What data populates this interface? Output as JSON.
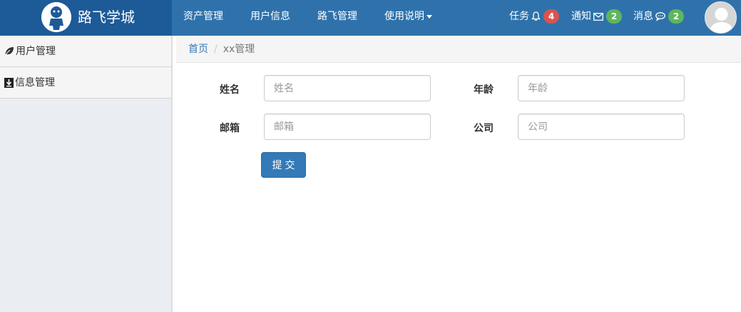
{
  "brand": {
    "title": "路飞学城"
  },
  "nav": {
    "items": [
      {
        "label": "资产管理"
      },
      {
        "label": "用户信息"
      },
      {
        "label": "路飞管理"
      },
      {
        "label": "使用说明"
      }
    ]
  },
  "notifications": {
    "tasks": {
      "label": "任务",
      "count": "4",
      "icon": "bell-icon"
    },
    "notices": {
      "label": "通知",
      "count": "2",
      "icon": "envelope-icon"
    },
    "messages": {
      "label": "消息",
      "count": "2",
      "icon": "comment-icon"
    }
  },
  "sidebar": {
    "items": [
      {
        "label": "用户管理",
        "icon": "leaf-icon"
      },
      {
        "label": "信息管理",
        "icon": "download-icon"
      }
    ]
  },
  "breadcrumb": {
    "home": "首页",
    "current": "xx管理"
  },
  "form": {
    "name": {
      "label": "姓名",
      "placeholder": "姓名",
      "value": ""
    },
    "age": {
      "label": "年龄",
      "placeholder": "年龄",
      "value": ""
    },
    "email": {
      "label": "邮箱",
      "placeholder": "邮箱",
      "value": ""
    },
    "company": {
      "label": "公司",
      "placeholder": "公司",
      "value": ""
    },
    "submit_label": "提交"
  },
  "colors": {
    "topbar": "#2f72ab",
    "brand_bg": "#1d5a98",
    "primary": "#337ab7",
    "badge_red": "#d9534f",
    "badge_green": "#5cb85c",
    "sidebar_bg": "#eaedf1"
  }
}
